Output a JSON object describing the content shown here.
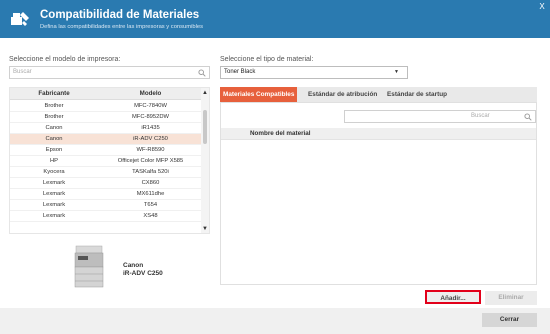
{
  "header": {
    "title": "Compatibilidad de Materiales",
    "subtitle": "Defina las compatibilidades entre las impresoras y consumibles",
    "close_label": "X",
    "bg_color": "#2a7ab0"
  },
  "left": {
    "model_label": "Seleccione el modelo de impresora:",
    "search_placeholder": "Buscar",
    "columns": {
      "manufacturer": "Fabricante",
      "model": "Modelo"
    },
    "rows": [
      {
        "manufacturer": "Brother",
        "model": "MFC-7840W"
      },
      {
        "manufacturer": "Brother",
        "model": "MFC-8952DW"
      },
      {
        "manufacturer": "Canon",
        "model": "iR1435"
      },
      {
        "manufacturer": "Canon",
        "model": "iR-ADV C250"
      },
      {
        "manufacturer": "Epson",
        "model": "WF-R8590"
      },
      {
        "manufacturer": "HP",
        "model": "Officejet Color MFP X585"
      },
      {
        "manufacturer": "Kyocera",
        "model": "TASKalfa 520i"
      },
      {
        "manufacturer": "Lexmark",
        "model": "CX860"
      },
      {
        "manufacturer": "Lexmark",
        "model": "MX611dhe"
      },
      {
        "manufacturer": "Lexmark",
        "model": "T654"
      },
      {
        "manufacturer": "Lexmark",
        "model": "XS48"
      }
    ],
    "selected_index": 3,
    "selected_printer": {
      "brand": "Canon",
      "model": "iR-ADV C250"
    }
  },
  "right": {
    "material_label": "Seleccione el tipo de material:",
    "material_value": "Toner Black",
    "tabs": [
      {
        "label": "Materiales Compatibles",
        "active": true
      },
      {
        "label": "Estándar de atribución",
        "active": false
      },
      {
        "label": "Estándar de startup",
        "active": false
      }
    ],
    "search_placeholder": "Buscar",
    "column_header": "Nombre del material"
  },
  "buttons": {
    "add": "Añadir...",
    "delete": "Eliminar",
    "close": "Cerrar"
  },
  "colors": {
    "accent": "#e7603c",
    "selected_row": "#f8e2d6",
    "highlight_border": "#e2001a"
  },
  "icons": {
    "header": "printer-consumables-icon",
    "search": "search-icon",
    "dropdown": "chevron-down-icon",
    "scroll_up": "chevron-up-icon",
    "scroll_down": "chevron-down-icon"
  }
}
